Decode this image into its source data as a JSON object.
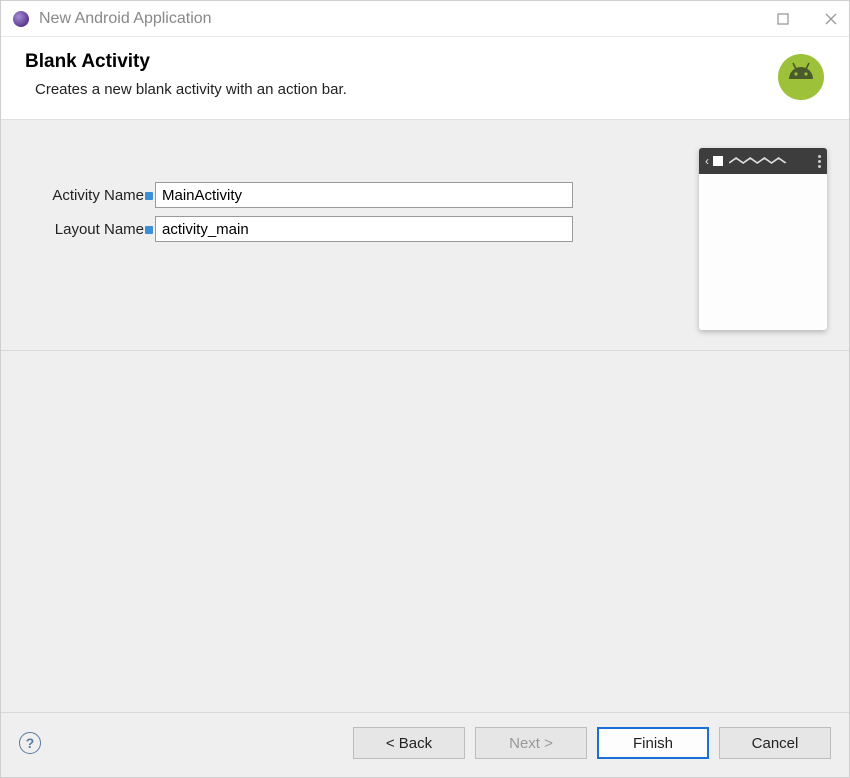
{
  "window": {
    "title": "New Android Application"
  },
  "header": {
    "title": "Blank Activity",
    "subtitle": "Creates a new blank activity with an action bar."
  },
  "form": {
    "activity_name": {
      "label": "Activity Name",
      "value": "MainActivity"
    },
    "layout_name": {
      "label": "Layout Name",
      "value": "activity_main"
    }
  },
  "buttons": {
    "back": "< Back",
    "next": "Next >",
    "finish": "Finish",
    "cancel": "Cancel"
  },
  "icons": {
    "help": "?"
  }
}
